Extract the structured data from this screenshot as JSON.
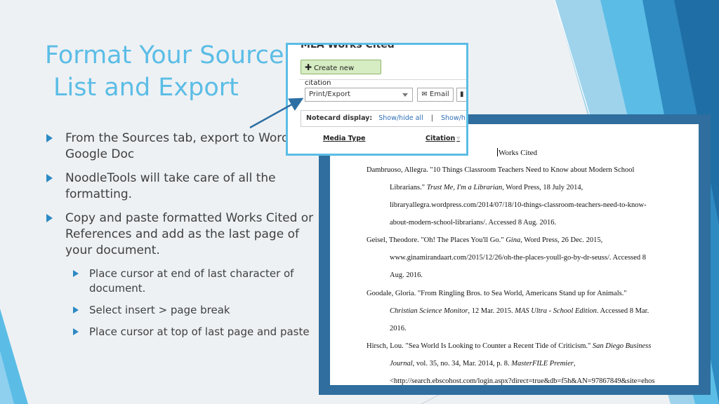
{
  "slide": {
    "title_line1": "Format Your Source",
    "title_line2": "List and Export",
    "bullets": [
      {
        "text": "From the Sources tab, export to Word or a Google Doc"
      },
      {
        "text": "NoodleTools will take care of all the formatting."
      },
      {
        "text": "Copy and paste formatted Works Cited or References and add as the last page of your document."
      }
    ],
    "sub_bullets": [
      {
        "text": "Place cursor at end of last character of document."
      },
      {
        "text": "Select insert > page break"
      },
      {
        "text": "Place cursor at top of last page and paste"
      }
    ],
    "colors": {
      "title": "#5bbde6",
      "accent_dark": "#2f6e9e",
      "accent_light": "#5bbde6",
      "arrow": "#2d8ac4"
    }
  },
  "noodletools": {
    "heading": "MLA Works Cited",
    "create_button": "Create new citation",
    "create_icon": "plus-icon",
    "export_select": "Print/Export",
    "email_button": "Email",
    "notecard_label": "Notecard display:",
    "show_hide_all": "Show/hide all",
    "separator": "|",
    "show_partial": "Show/h",
    "columns": [
      "Media Type",
      "Citation"
    ]
  },
  "document": {
    "heading": "Works Cited",
    "lines": [
      "Dambruoso, Allegra. \"10 Things Classroom Teachers Need to Know about Modern School",
      "Librarians.\" ",
      "Trust Me, I'm a Librarian",
      ", Word Press, 18 July 2014,",
      "libraryallegra.wordpress.com/2014/07/18/10-things-classroom-teachers-need-to-know-",
      "about-modern-school-librarians/. Accessed 8 Aug. 2016.",
      "Geisel, Theodore. \"Oh! The Places You'll Go.\" ",
      "Gina",
      ", Word Press, 26 Dec. 2015,",
      "www.ginamirandaart.com/2015/12/26/oh-the-places-youll-go-by-dr-seuss/. Accessed 8",
      "Aug. 2016.",
      "Goodale, Gloria. \"From Ringling Bros. to Sea World, Americans Stand up for Animals.\"",
      "Christian Science Monitor",
      ", 12 Mar. 2015. ",
      "MAS Ultra - School Edition",
      ". Accessed 8 Mar.",
      "2016.",
      "Hirsch, Lou. \"Sea World Is Looking to Counter a Recent Tide of Criticism.\" ",
      "San Diego Business",
      "Journal",
      ", vol. 35, no. 34, Mar. 2014, p. 8. ",
      "MasterFILE Premier",
      ",",
      "<http://search.ebscohost.com/login.aspx?direct=true&db=f5h&AN=97867849&site=ehos"
    ]
  }
}
